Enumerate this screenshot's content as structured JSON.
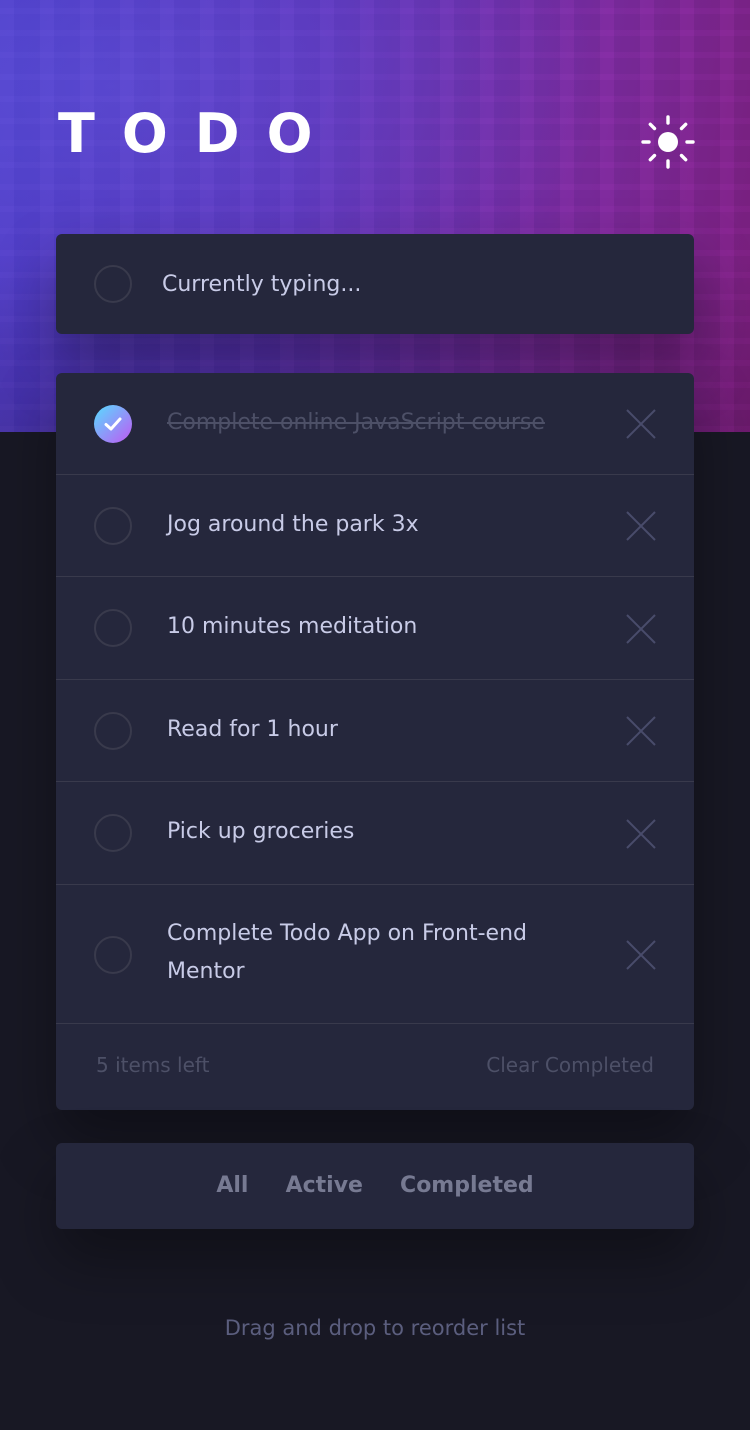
{
  "app": {
    "title": "TODO"
  },
  "theme_toggle": {
    "icon": "sun-icon"
  },
  "new_todo": {
    "value": "",
    "placeholder": "Currently typing..."
  },
  "todos": [
    {
      "text": "Complete online JavaScript course",
      "completed": true
    },
    {
      "text": "Jog around the park 3x",
      "completed": false
    },
    {
      "text": "10 minutes meditation",
      "completed": false
    },
    {
      "text": "Read for 1 hour",
      "completed": false
    },
    {
      "text": "Pick up groceries",
      "completed": false
    },
    {
      "text": "Complete Todo App on Front-end Mentor",
      "completed": false
    }
  ],
  "footer": {
    "items_left": "5 items left",
    "clear_label": "Clear Completed"
  },
  "filters": [
    {
      "label": "All"
    },
    {
      "label": "Active"
    },
    {
      "label": "Completed"
    }
  ],
  "hint": "Drag and drop to reorder list",
  "colors": {
    "check_gradient_start": "#57ddff",
    "check_gradient_end": "#c058f3",
    "card_bg": "#25273c",
    "page_bg": "#181824"
  }
}
